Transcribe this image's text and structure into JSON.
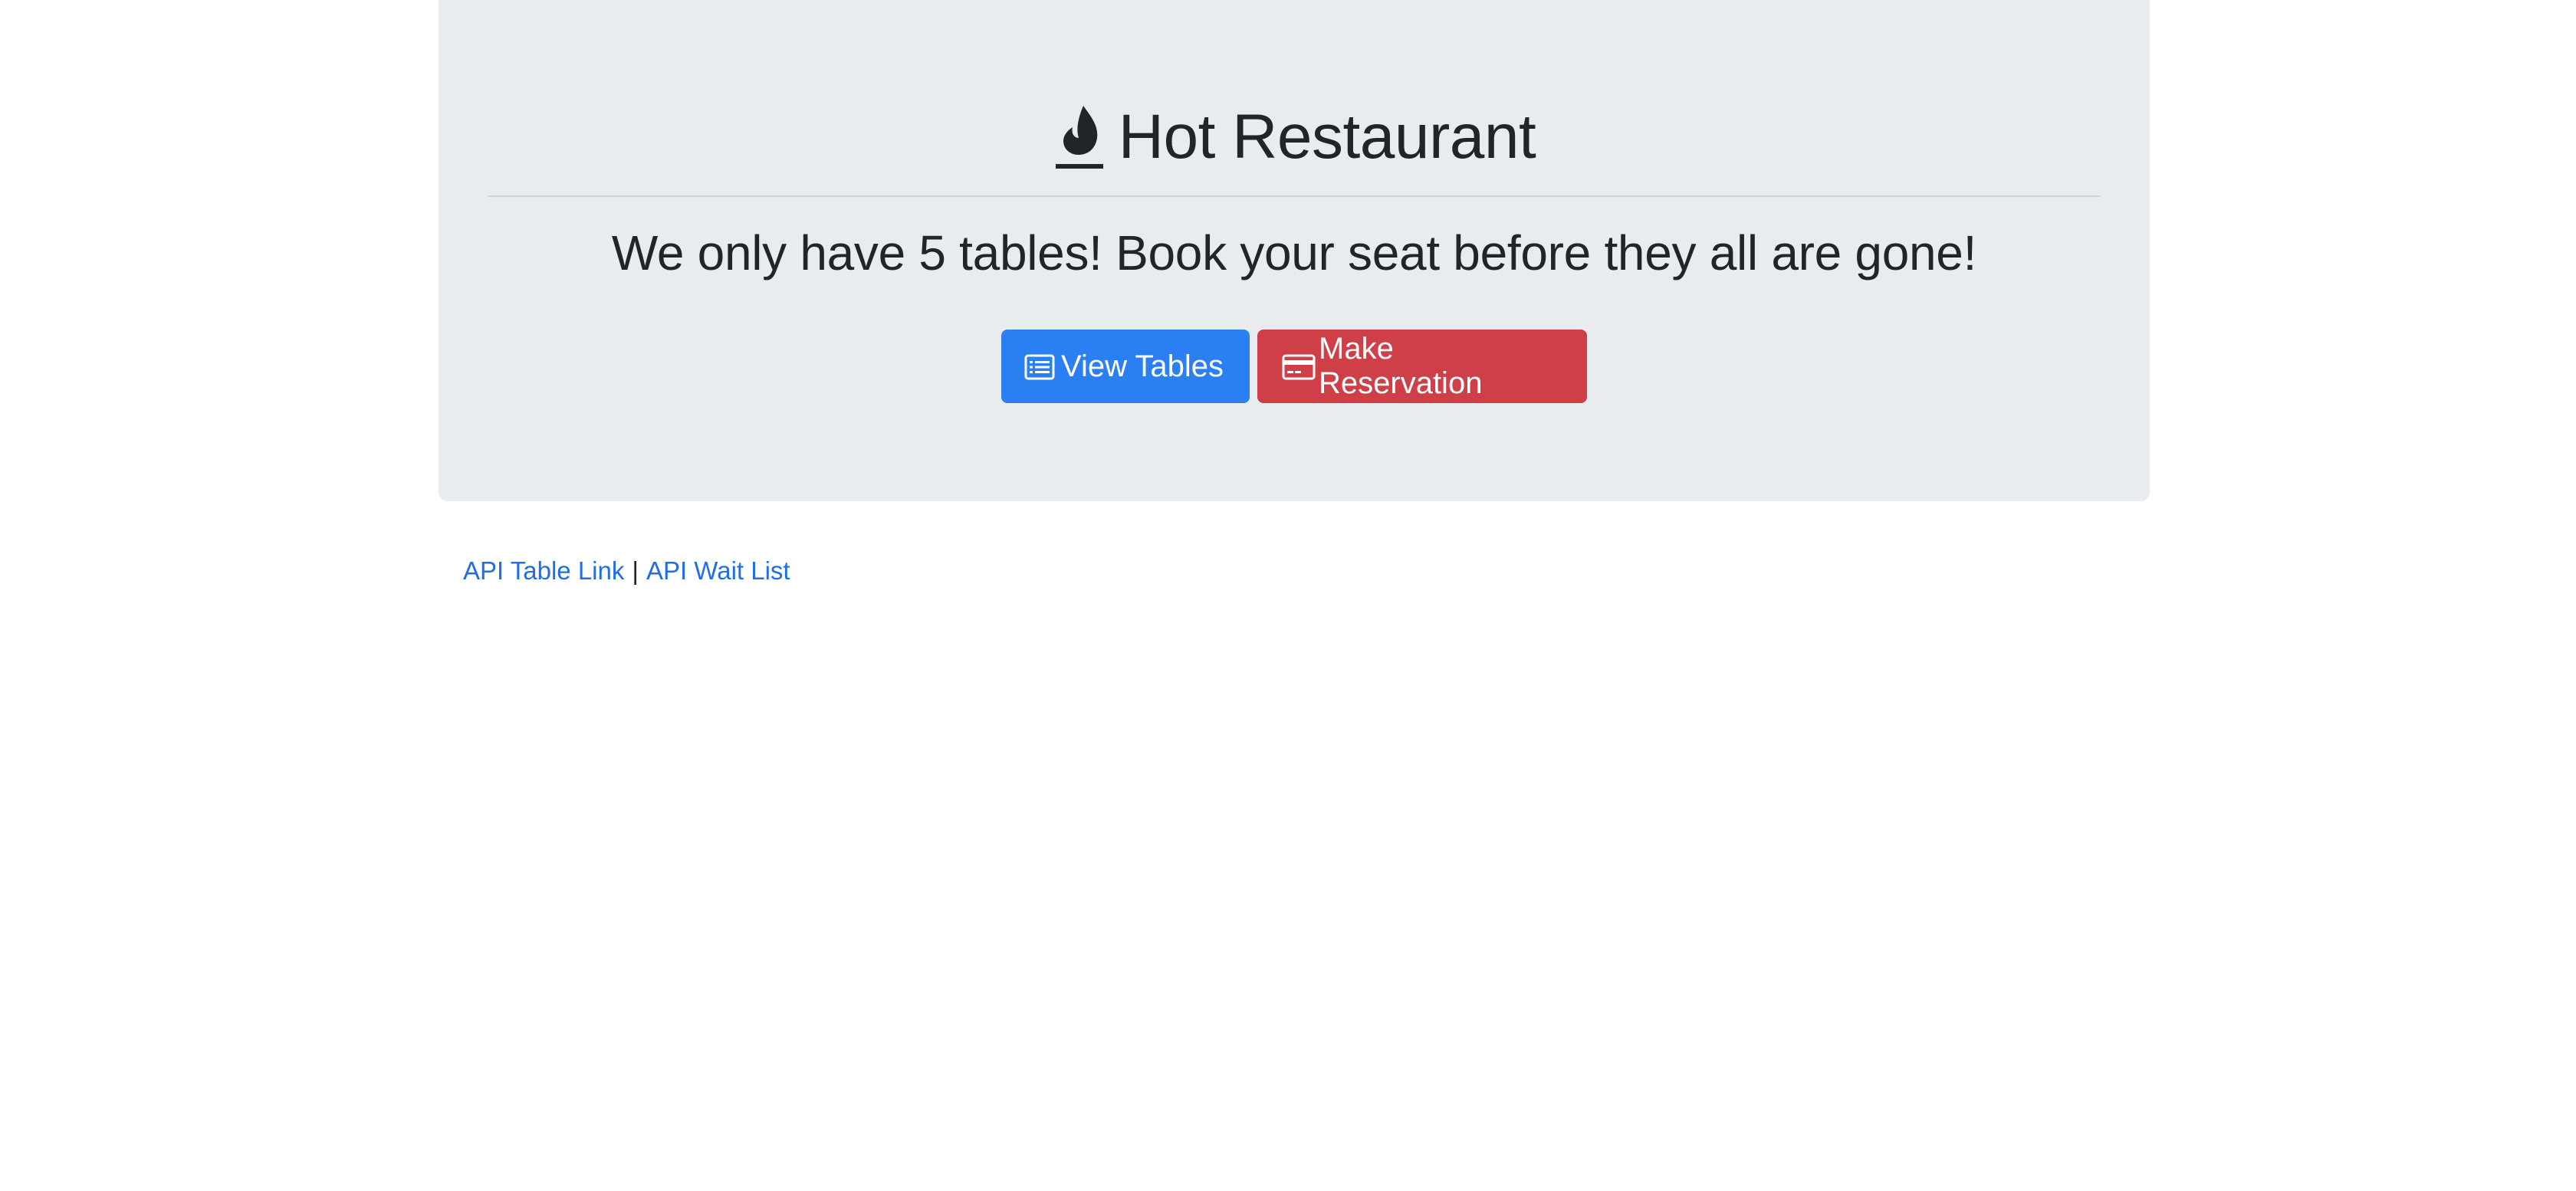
{
  "header": {
    "title": "Hot Restaurant",
    "title_icon": "fire-icon",
    "subtitle": "We only have 5 tables! Book your seat before they all are gone!"
  },
  "actions": {
    "view_tables_label": "View Tables",
    "view_tables_icon": "list-alt-icon",
    "make_reservation_label": "Make Reservation",
    "make_reservation_icon": "credit-card-icon"
  },
  "footer_links": {
    "api_table_label": "API Table Link",
    "separator": "|",
    "api_waitlist_label": "API Wait List"
  },
  "colors": {
    "jumbotron_bg": "#e9ecef",
    "primary": "#2a7ff3",
    "danger": "#cf3f48",
    "link": "#1f6fe3",
    "text": "#212529"
  }
}
